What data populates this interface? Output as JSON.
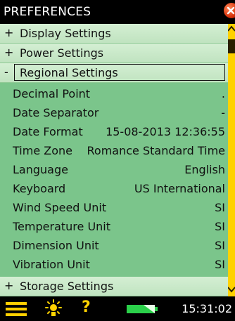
{
  "window": {
    "title": "PREFERENCES"
  },
  "groups": [
    {
      "sign": "+",
      "label": "Display Settings"
    },
    {
      "sign": "+",
      "label": "Power Settings"
    },
    {
      "sign": "-",
      "label": "Regional Settings"
    },
    {
      "sign": "+",
      "label": "Storage Settings"
    }
  ],
  "regional": {
    "decimal_point": {
      "label": "Decimal Point",
      "value": "."
    },
    "date_separator": {
      "label": "Date Separator",
      "value": "-"
    },
    "date_format": {
      "label": "Date Format",
      "value": "15-08-2013 12:36:55"
    },
    "time_zone": {
      "label": "Time Zone",
      "value": "Romance Standard Time"
    },
    "language": {
      "label": "Language",
      "value": "English"
    },
    "keyboard": {
      "label": "Keyboard",
      "value": "US International"
    },
    "wind_speed_unit": {
      "label": "Wind Speed Unit",
      "value": "SI"
    },
    "temperature_unit": {
      "label": "Temperature Unit",
      "value": "SI"
    },
    "dimension_unit": {
      "label": "Dimension Unit",
      "value": "SI"
    },
    "vibration_unit": {
      "label": "Vibration Unit",
      "value": "SI"
    }
  },
  "status": {
    "time": "15:31:02"
  },
  "colors": {
    "list_bg": "#7bc58b",
    "group_bg": "#c8e8c8",
    "accent": "#ffd200",
    "close": "#e0400f"
  },
  "icons": [
    "close-icon",
    "menu-icon",
    "sun-icon",
    "help-icon",
    "battery-icon",
    "scroll-up-icon",
    "scroll-down-icon"
  ]
}
